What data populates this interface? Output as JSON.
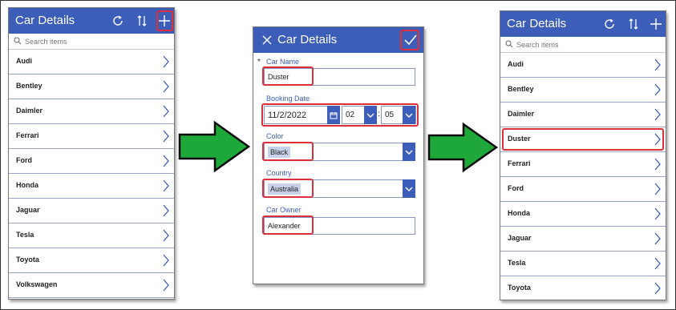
{
  "left_screen": {
    "title": "Car Details",
    "search_placeholder": "Search items",
    "items": [
      "Audi",
      "Bentley",
      "Daimler",
      "Ferrari",
      "Ford",
      "Honda",
      "Jaguar",
      "Tesla",
      "Toyota",
      "Volkswagen"
    ]
  },
  "form_screen": {
    "title": "Car Details",
    "required_mark": "*",
    "car_name_label": "Car Name",
    "car_name_value": "Duster",
    "booking_date_label": "Booking Date",
    "booking_date_value": "11/2/2022",
    "hour_value": "02",
    "minute_separator": ":",
    "minute_value": "05",
    "color_label": "Color",
    "color_value": "Black",
    "country_label": "Country",
    "country_value": "Australia",
    "owner_label": "Car Owner",
    "owner_value": "Alexander"
  },
  "right_screen": {
    "title": "Car Details",
    "search_placeholder": "Search items",
    "items": [
      "Audi",
      "Bentley",
      "Daimler",
      "Duster",
      "Ferrari",
      "Ford",
      "Honda",
      "Jaguar",
      "Tesla",
      "Toyota"
    ]
  },
  "colors": {
    "header": "#3c5db8",
    "highlight": "#d9303a",
    "arrow_fill": "#1fa83a",
    "arrow_stroke": "#0a0a0a"
  }
}
